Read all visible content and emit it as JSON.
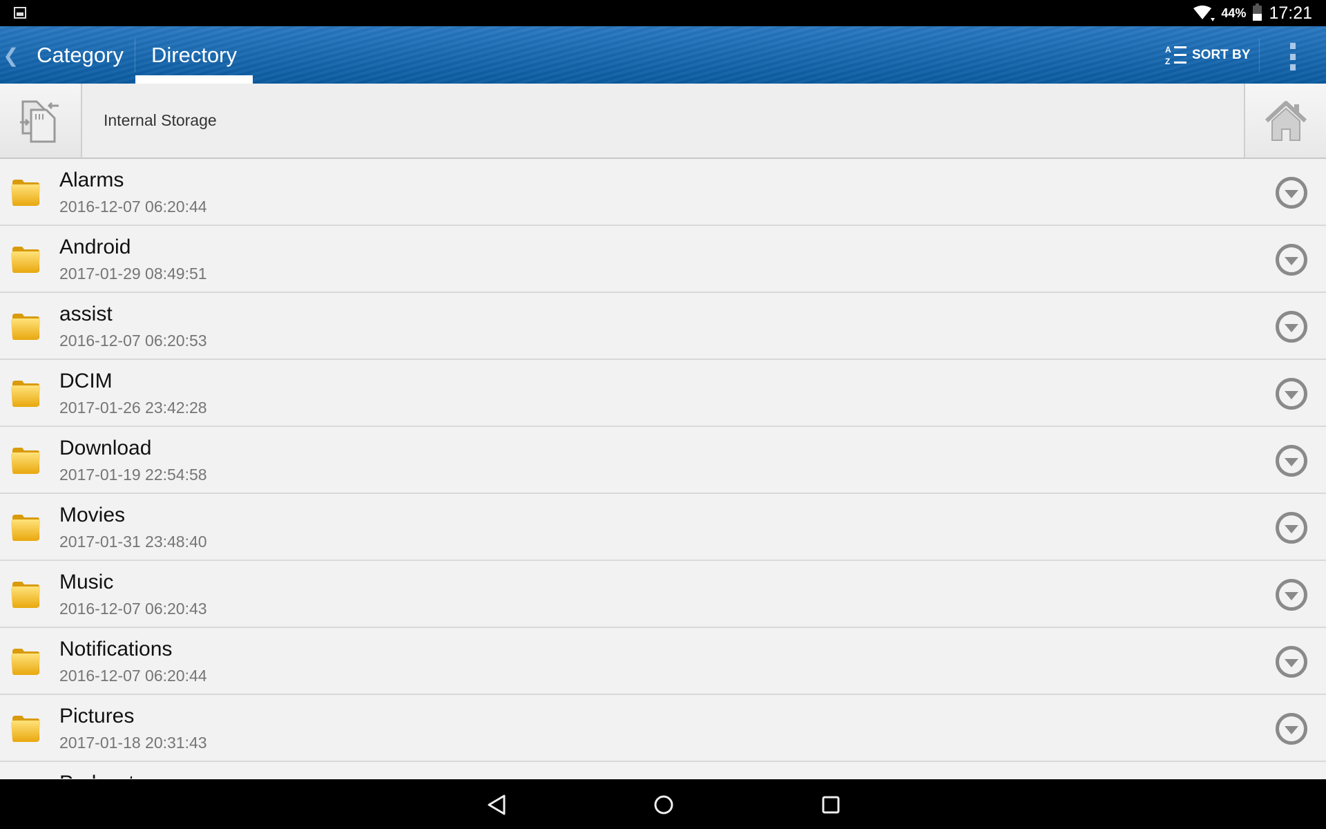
{
  "status_bar": {
    "notification_icon": "image-icon",
    "wifi_icon": "wifi-icon",
    "battery_percent": "44%",
    "battery_level": 0.44,
    "time": "17:21"
  },
  "app_bar": {
    "back_icon": "chevron-left-icon",
    "tabs": [
      {
        "label": "Category",
        "selected": false
      },
      {
        "label": "Directory",
        "selected": true
      }
    ],
    "sort_label": "SORT BY",
    "sort_icon": "sort-az-icon",
    "overflow_icon": "more-vert-icon"
  },
  "storage": {
    "label": "Internal Storage",
    "icon": "sd-card-switch-icon",
    "home_icon": "home-icon"
  },
  "files": [
    {
      "name": "Alarms",
      "date": "2016-12-07 06:20:44"
    },
    {
      "name": "Android",
      "date": "2017-01-29 08:49:51"
    },
    {
      "name": "assist",
      "date": "2016-12-07 06:20:53"
    },
    {
      "name": "DCIM",
      "date": "2017-01-26 23:42:28"
    },
    {
      "name": "Download",
      "date": "2017-01-19 22:54:58"
    },
    {
      "name": "Movies",
      "date": "2017-01-31 23:48:40"
    },
    {
      "name": "Music",
      "date": "2016-12-07 06:20:43"
    },
    {
      "name": "Notifications",
      "date": "2016-12-07 06:20:44"
    },
    {
      "name": "Pictures",
      "date": "2017-01-18 20:31:43"
    },
    {
      "name": "Podcasts",
      "date": ""
    }
  ],
  "nav_bar": {
    "back": "back-icon",
    "home": "home-circle-icon",
    "recents": "recents-icon"
  },
  "colors": {
    "app_bar_top": "#2a78c1",
    "app_bar_bottom": "#0a5a9f",
    "folder": "#f2b824"
  }
}
